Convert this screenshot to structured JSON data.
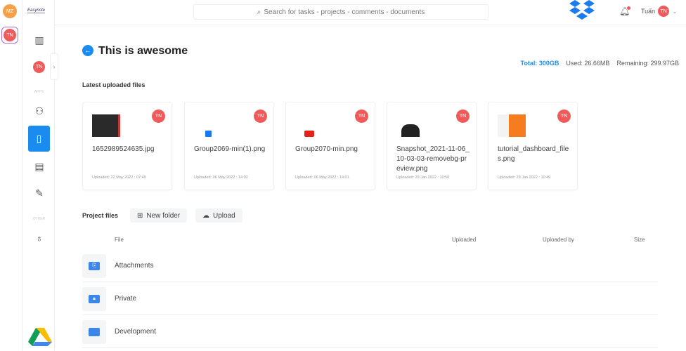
{
  "rail": {
    "avatars": [
      {
        "initials": "MZ",
        "color": "#f5a04a"
      },
      {
        "initials": "TN",
        "color": "#ef5b5b"
      }
    ]
  },
  "sidebar": {
    "logo": "Easynote",
    "user_initials": "TN",
    "apps_label": "APPS",
    "other_label": "OTHER"
  },
  "topbar": {
    "search_placeholder": "Search for tasks - projects - comments - documents",
    "user_name": "Tuấn",
    "user_initials": "TN"
  },
  "page": {
    "title": "This is awesome"
  },
  "storage": {
    "total": "Total: 300GB",
    "used": "Used: 26.66MB",
    "remaining": "Remaining: 299.97GB"
  },
  "latest": {
    "heading": "Latest uploaded files",
    "files": [
      {
        "name": "1652989524635.jpg",
        "uploaded": "Uploaded: 22 May 2022 : 07:49",
        "initials": "TN"
      },
      {
        "name": "Group2069-min(1).png",
        "uploaded": "Uploaded: 06 May 2022 : 14:02",
        "initials": "TN"
      },
      {
        "name": "Group2070-min.png",
        "uploaded": "Uploaded: 06 May 2022 : 14:01",
        "initials": "TN"
      },
      {
        "name": "Snapshot_2021-11-06_10-03-03-removebg-preview.png",
        "uploaded": "Uploaded: 29 Jan 2022 : 10:50",
        "initials": "TN"
      },
      {
        "name": "tutorial_dashboard_files.png",
        "uploaded": "Uploaded: 29 Jan 2022 : 10:49",
        "initials": "TN"
      }
    ]
  },
  "project": {
    "heading": "Project files",
    "new_folder": "New folder",
    "upload": "Upload",
    "columns": {
      "file": "File",
      "uploaded": "Uploaded",
      "uploaded_by": "Uploaded by",
      "size": "Size"
    },
    "folders": [
      {
        "name": "Attachments"
      },
      {
        "name": "Private"
      },
      {
        "name": "Development"
      }
    ]
  },
  "colors": {
    "accent": "#1a8cf0",
    "avatar": "#ef5b5b"
  }
}
